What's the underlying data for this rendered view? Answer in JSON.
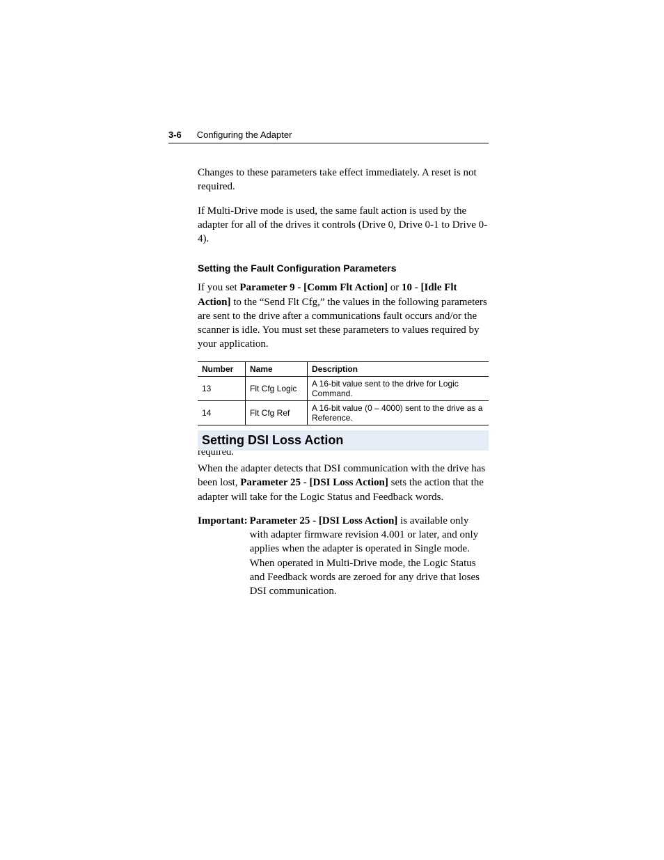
{
  "header": {
    "page_number": "3-6",
    "title": "Configuring the Adapter"
  },
  "intro": {
    "p1": "Changes to these parameters take effect immediately. A reset is not required.",
    "p2": "If Multi-Drive mode is used, the same fault action is used by the adapter for all of the drives it controls (Drive 0, Drive 0-1 to Drive 0-4)."
  },
  "fault_cfg": {
    "heading": "Setting the Fault Configuration Parameters",
    "p1_a": "If you set ",
    "p1_b": "Parameter 9 - [Comm Flt Action]",
    "p1_c": " or ",
    "p1_d": "10 - [Idle Flt Action]",
    "p1_e": " to the “Send Flt Cfg,” the values in the following parameters are sent to the drive after a communications fault occurs and/or the scanner is idle. You must set these parameters to values required by your application.",
    "table": {
      "headers": {
        "number": "Number",
        "name": "Name",
        "description": "Description"
      },
      "rows": [
        {
          "number": "13",
          "name": "Flt Cfg Logic",
          "description": "A 16-bit value sent to the drive for Logic Command."
        },
        {
          "number": "14",
          "name": "Flt Cfg Ref",
          "description": "A 16-bit value (0 – 4000) sent to the drive as a Reference."
        }
      ]
    },
    "after": "Changes to these parameters take effect immediately. A reset is not required."
  },
  "dsi": {
    "heading": "Setting DSI Loss Action",
    "p1_a": "When the adapter detects that DSI communication with the drive has been lost, ",
    "p1_b": "Parameter 25 - [DSI Loss Action]",
    "p1_c": " sets the action that the adapter will take for the Logic Status and Feedback words.",
    "important_label": "Important:",
    "important_b1": "Parameter 25 - [DSI Loss Action]",
    "important_b2": " is available only with adapter firmware revision 4.001 or later, and only applies when the adapter is operated in Single mode. When operated in Multi-Drive mode, the Logic Status and Feedback words are zeroed for any drive that loses DSI communication."
  }
}
